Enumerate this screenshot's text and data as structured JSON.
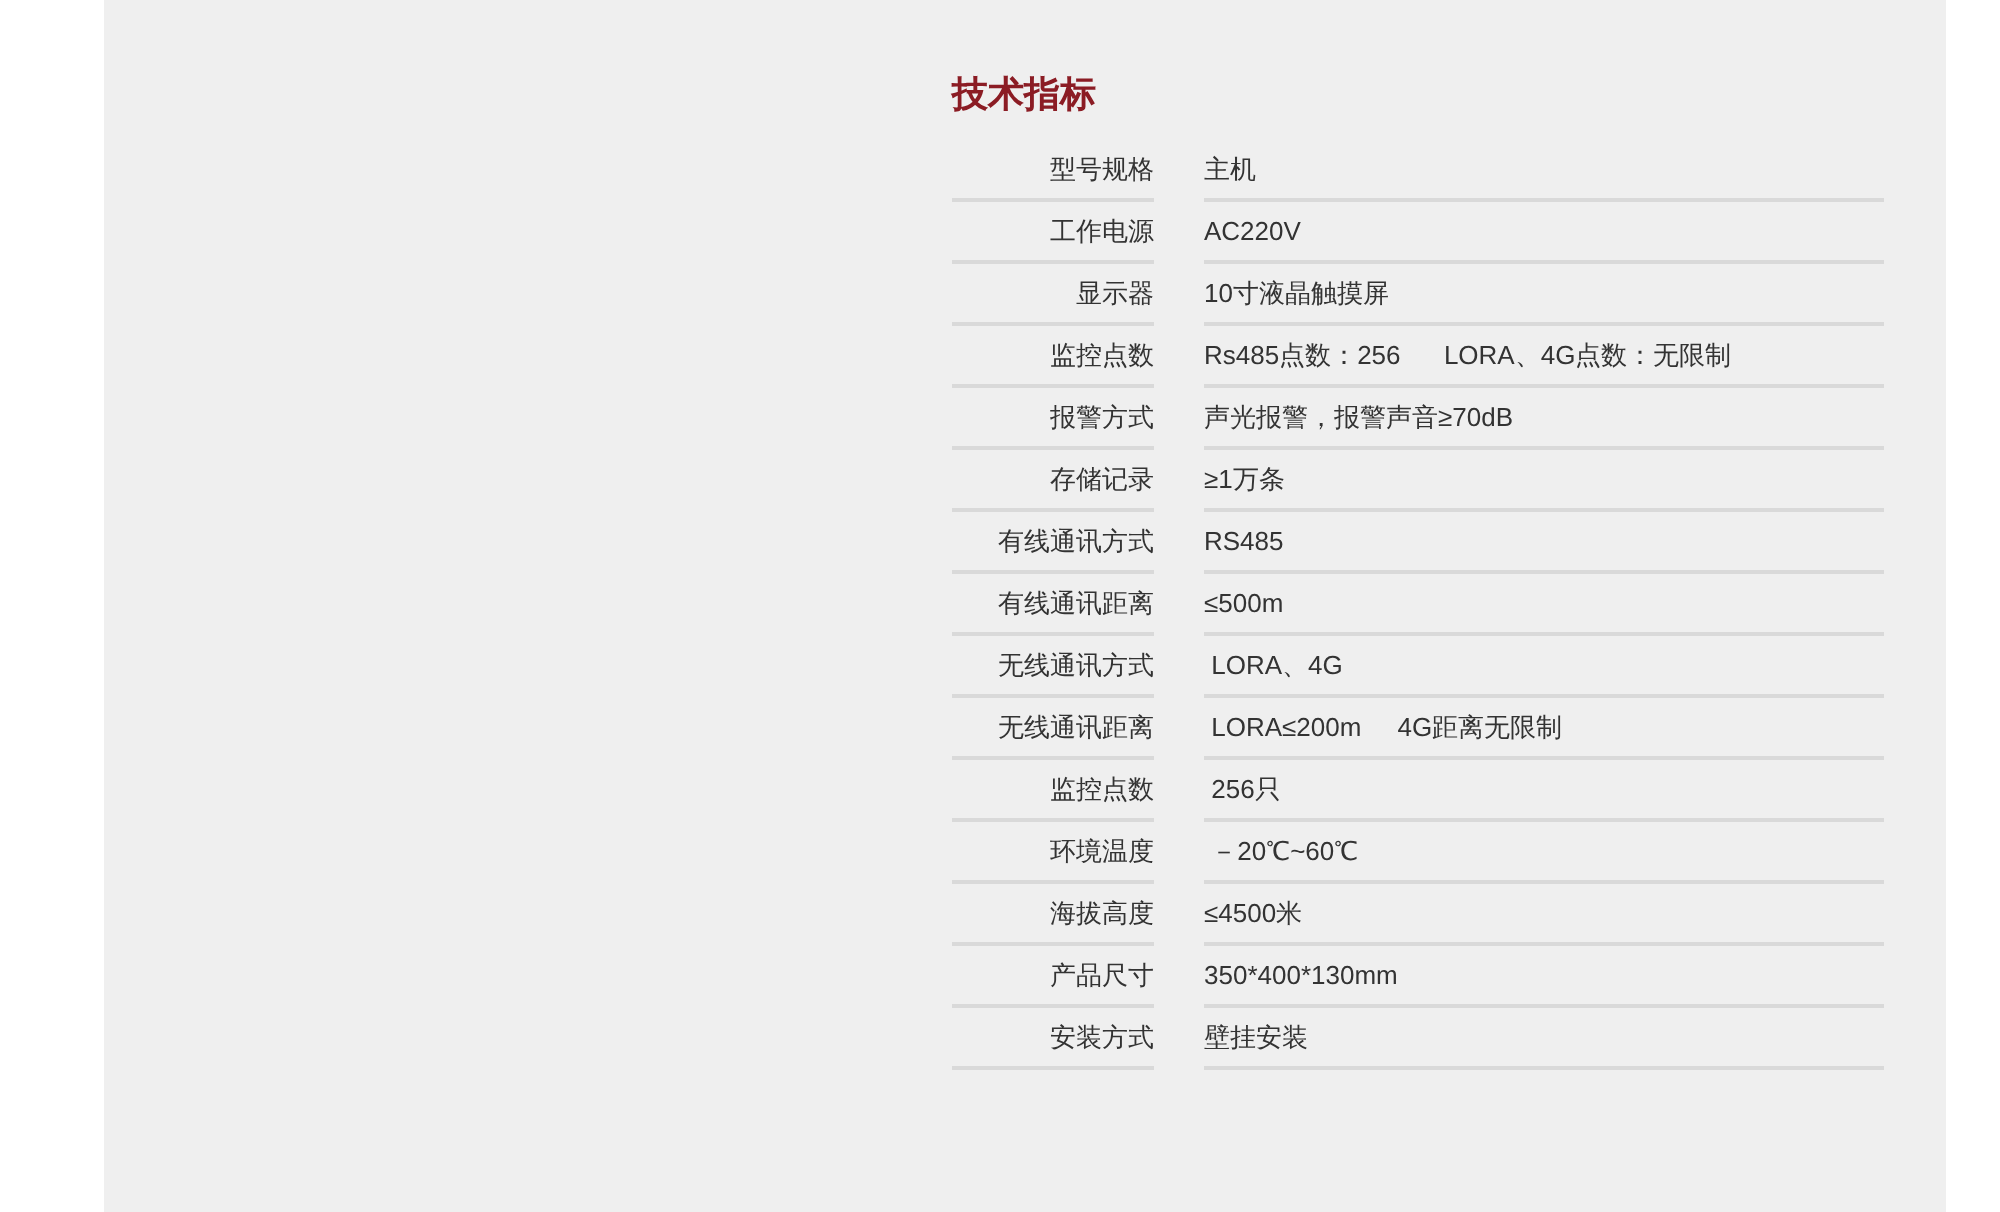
{
  "title": "技术指标",
  "specs": [
    {
      "label": "型号规格",
      "value": "主机"
    },
    {
      "label": "工作电源",
      "value": "AC220V"
    },
    {
      "label": "显示器",
      "value": "10寸液晶触摸屏"
    },
    {
      "label": "监控点数",
      "value": "Rs485点数：256      LORA、4G点数：无限制"
    },
    {
      "label": "报警方式",
      "value": "声光报警，报警声音≥70dB"
    },
    {
      "label": "存储记录",
      "value": "≥1万条"
    },
    {
      "label": "有线通讯方式",
      "value": "RS485"
    },
    {
      "label": "有线通讯距离",
      "value": "≤500m"
    },
    {
      "label": "无线通讯方式",
      "value": " LORA、4G"
    },
    {
      "label": "无线通讯距离",
      "value": " LORA≤200m     4G距离无限制"
    },
    {
      "label": "监控点数",
      "value": " 256只"
    },
    {
      "label": "环境温度",
      "value": " －20℃~60℃"
    },
    {
      "label": "海拔高度",
      "value": "≤4500米"
    },
    {
      "label": "产品尺寸",
      "value": "350*400*130mm"
    },
    {
      "label": "安装方式",
      "value": "壁挂安装"
    }
  ]
}
